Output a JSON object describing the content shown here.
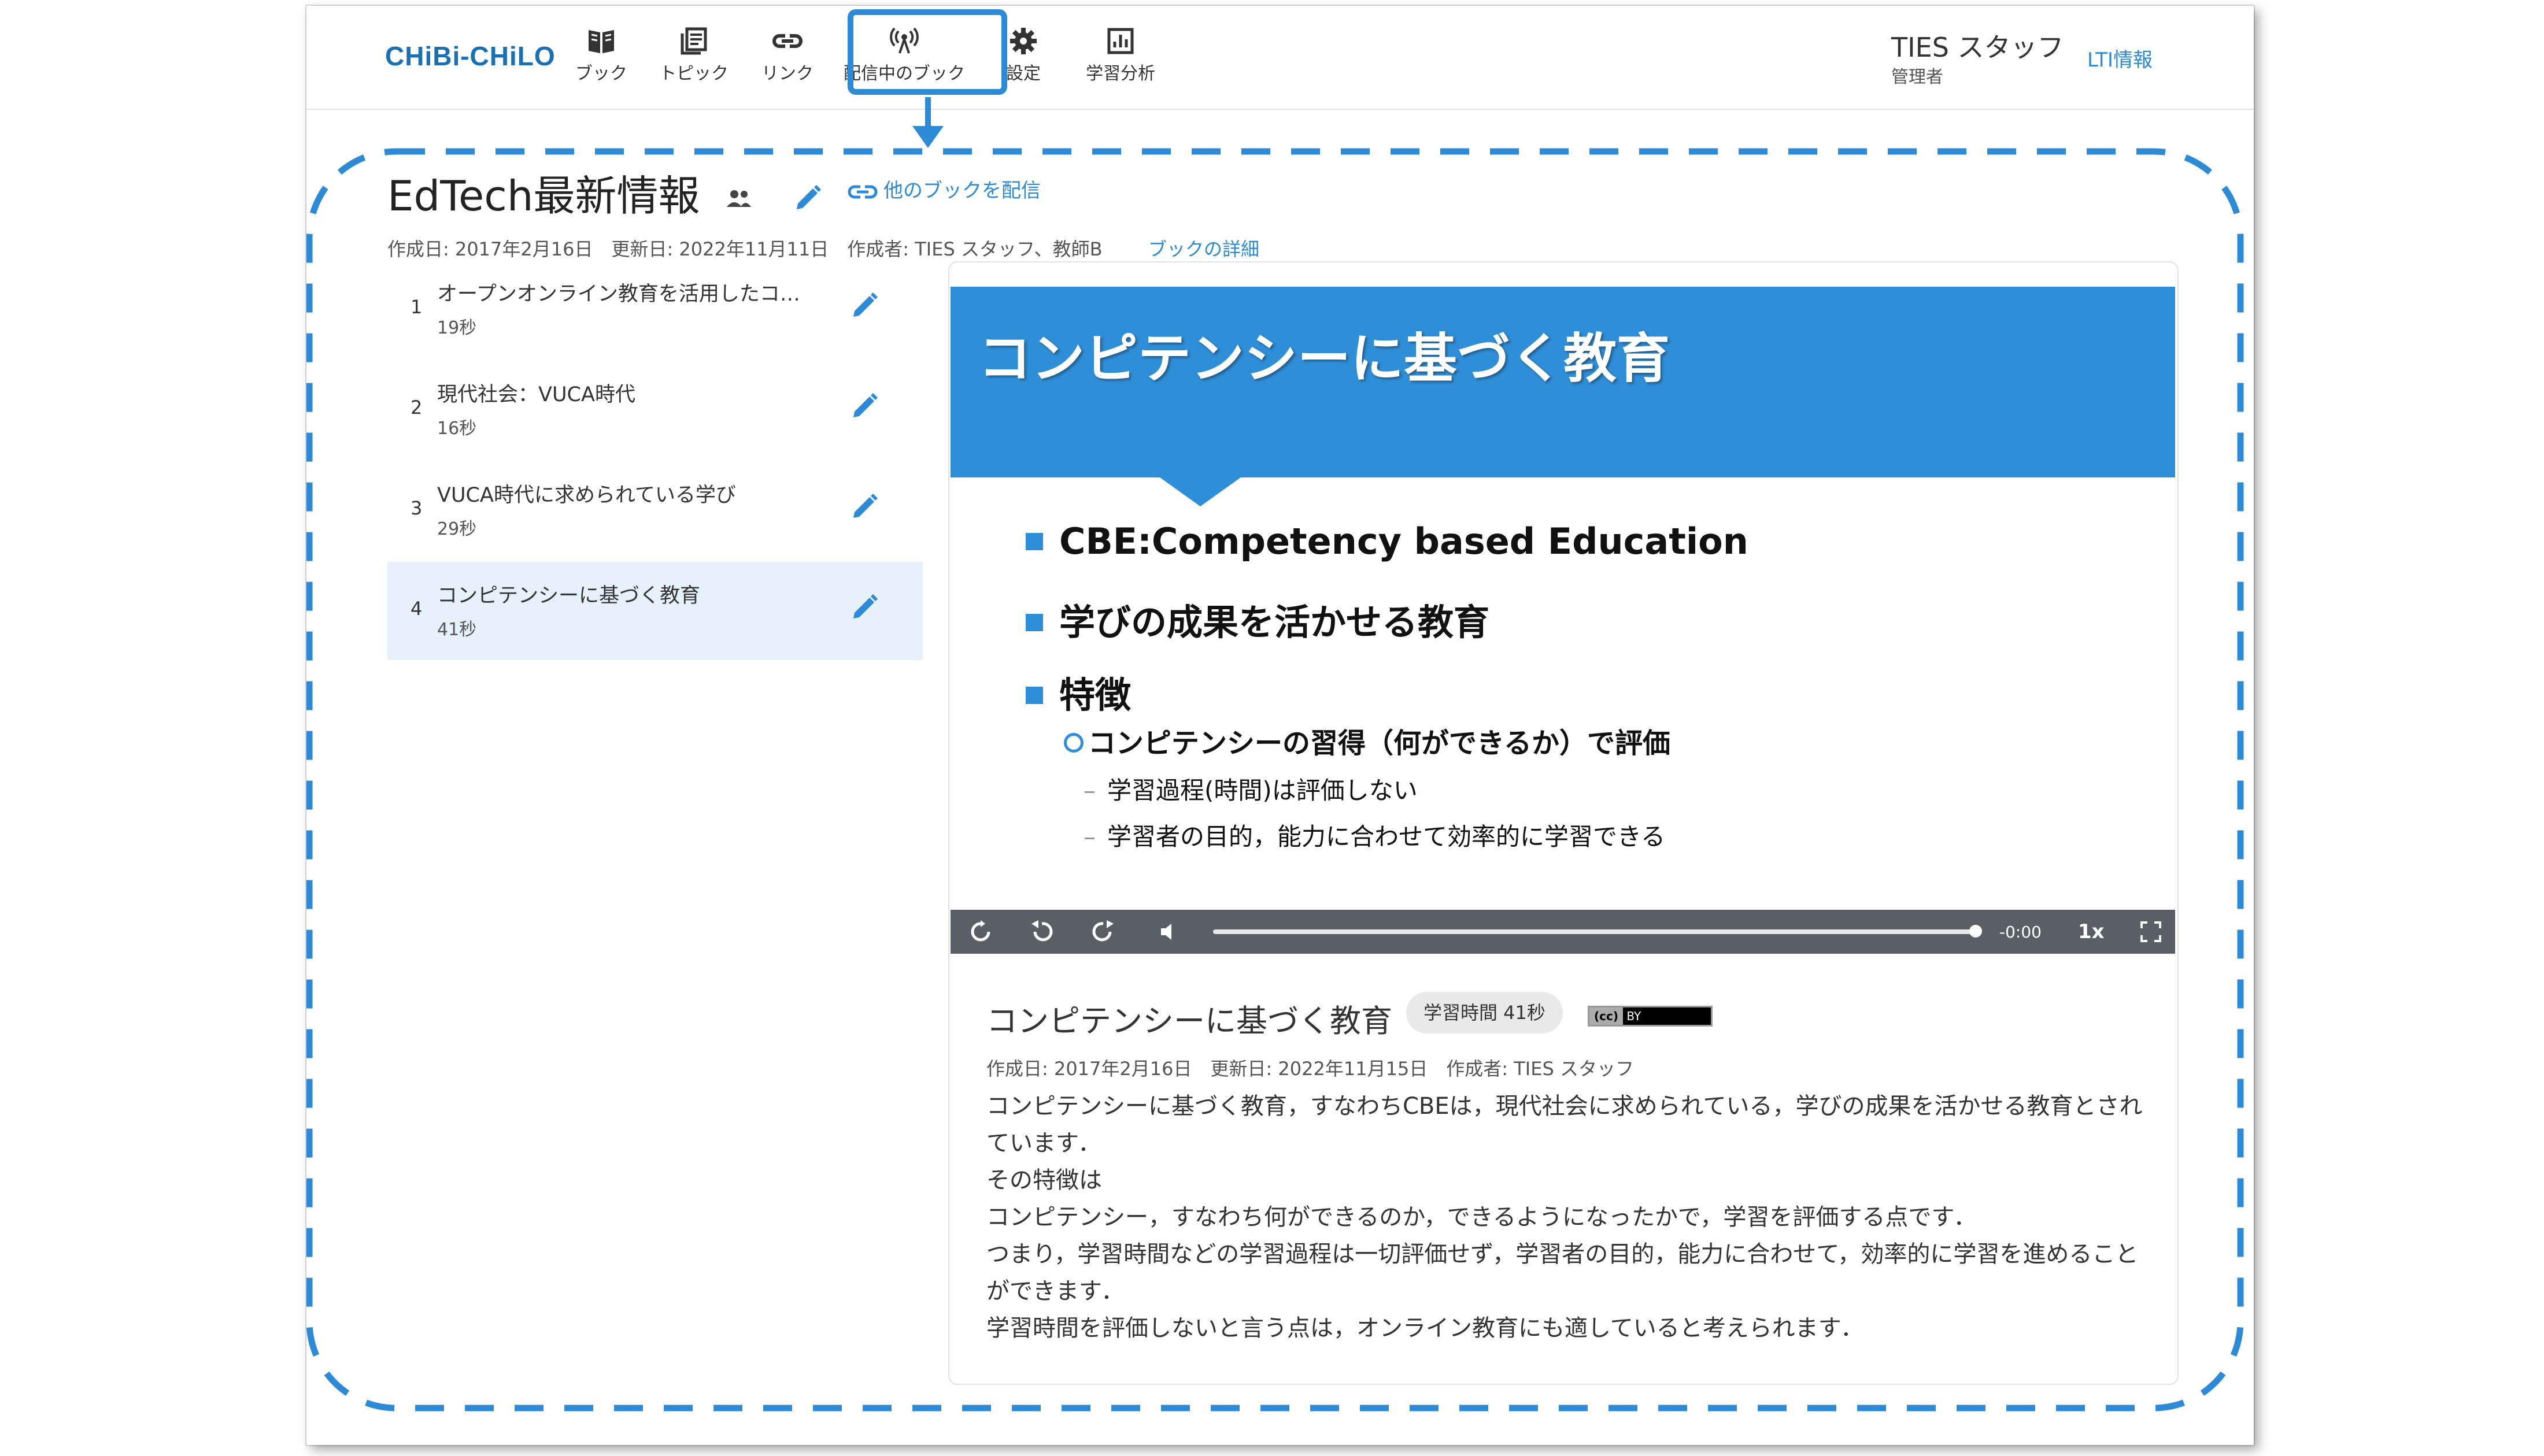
{
  "app": {
    "logo": "CHiBi-CHiLO",
    "accent_color": "#2d8ad6",
    "nav": [
      {
        "label": "ブック",
        "icon": "book-icon"
      },
      {
        "label": "トピック",
        "icon": "topic-icon"
      },
      {
        "label": "リンク",
        "icon": "link-icon"
      },
      {
        "label": "配信中のブック",
        "icon": "broadcast-icon"
      },
      {
        "label": "設定",
        "icon": "gear-icon"
      },
      {
        "label": "学習分析",
        "icon": "analytics-icon"
      }
    ],
    "user": {
      "name": "TIES スタッフ",
      "role": "管理者"
    },
    "lti_link": "LTI情報"
  },
  "book": {
    "title": "EdTech最新情報",
    "other_book_link": "他のブックを配信",
    "meta": "作成日: 2017年2月16日　更新日: 2022年11月11日　作成者: TIES スタッフ、教師B",
    "detail_link": "ブックの詳細"
  },
  "topics": [
    {
      "num": "1",
      "title": "オープンオンライン教育を活用したコ…",
      "duration": "19秒"
    },
    {
      "num": "2",
      "title": "現代社会：VUCA時代",
      "duration": "16秒"
    },
    {
      "num": "3",
      "title": "VUCA時代に求められている学び",
      "duration": "29秒"
    },
    {
      "num": "4",
      "title": "コンピテンシーに基づく教育",
      "duration": "41秒"
    }
  ],
  "slide": {
    "title": "コンピテンシーに基づく教育",
    "bullets": [
      "CBE:Competency based Education",
      "学びの成果を活かせる教育",
      "特徴"
    ],
    "sub": "コンピテンシーの習得（何ができるか）で評価",
    "subsub": [
      "学習過程(時間)は評価しない",
      "学習者の目的，能力に合わせて効率的に学習できる"
    ]
  },
  "player": {
    "time": "-0:00",
    "rate": "1x"
  },
  "topic_detail": {
    "title": "コンピテンシーに基づく教育",
    "badge": "学習時間 41秒",
    "license": "BY",
    "meta": "作成日: 2017年2月16日　更新日: 2022年11月15日　作成者: TIES スタッフ",
    "body": [
      "コンピテンシーに基づく教育，すなわちCBEは，現代社会に求められている，学びの成果を活かせる教育とされています．",
      "その特徴は",
      "コンピテンシー，すなわち何ができるのか，できるようになったかで，学習を評価する点です．",
      "つまり，学習時間などの学習過程は一切評価せず，学習者の目的，能力に合わせて，効率的に学習を進めることができます．",
      "学習時間を評価しないと言う点は，オンライン教育にも適していると考えられます．"
    ]
  }
}
